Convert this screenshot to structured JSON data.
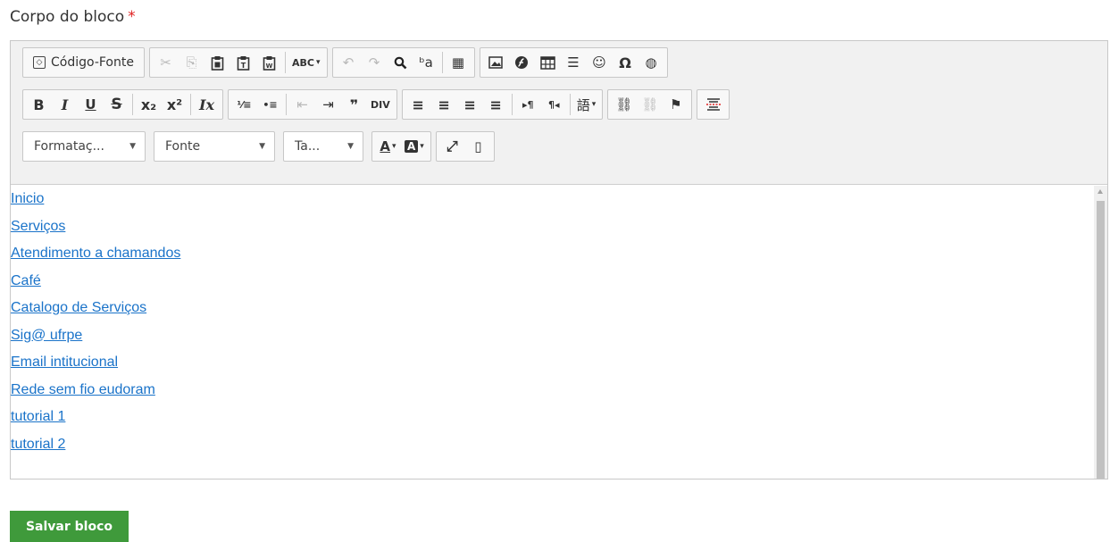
{
  "field": {
    "label": "Corpo do bloco",
    "required_mark": "*"
  },
  "toolbar": {
    "row1": {
      "source_label": "Código-Fonte",
      "cut": "✂",
      "copy": "⎘",
      "paste": "📋",
      "paste_text": "T",
      "paste_word": "W",
      "spell": "ABC",
      "undo": "↶",
      "redo": "↷",
      "find": "🔍",
      "replace": "ᵇa",
      "select_all": "▦",
      "image": "▣",
      "flash": "◐",
      "table": "⊞",
      "hr": "☰",
      "smiley": "☺",
      "omega": "Ω",
      "iframe": "◍"
    },
    "row2": {
      "bold": "B",
      "italic": "I",
      "underline": "U",
      "strike": "S",
      "subscript": "x₂",
      "superscript": "x²",
      "remove_format": "Ix",
      "ordered_list": "⅟≡",
      "bullet_list": "•≡",
      "outdent": "⇤",
      "indent": "⇥",
      "blockquote": "❞",
      "div": "DIV",
      "align_left": "≡",
      "align_center": "≡",
      "align_right": "≡",
      "align_justify": "≡",
      "ltr": "▸¶",
      "rtl": "¶◂",
      "language": "語",
      "link": "⛓",
      "unlink": "⛓",
      "anchor": "⚑",
      "page_break": "⊟"
    },
    "row3": {
      "format_label": "Formataç...",
      "font_label": "Fonte",
      "size_label": "Ta...",
      "text_color": "A",
      "bg_color": "A",
      "maximize": "⤢",
      "blocks": "▯"
    }
  },
  "content": {
    "items": [
      {
        "label": "Inicio"
      },
      {
        "label": "Serviços"
      }
    ],
    "sub_items": [
      {
        "label": "Atendimento a chamandos"
      },
      {
        "label": "Café"
      },
      {
        "label": "Catalogo de Serviços"
      },
      {
        "label": "Sig@ ufrpe"
      },
      {
        "label": "Email intitucional"
      },
      {
        "label": "Rede sem fio eudoram"
      }
    ],
    "sub_sub_items": [
      {
        "label": "tutorial 1"
      },
      {
        "label": "tutorial 2"
      }
    ]
  },
  "actions": {
    "save_label": "Salvar bloco"
  },
  "colors": {
    "save_bg": "#3f9a3b",
    "link": "#1a73c9",
    "required": "#e02020"
  }
}
